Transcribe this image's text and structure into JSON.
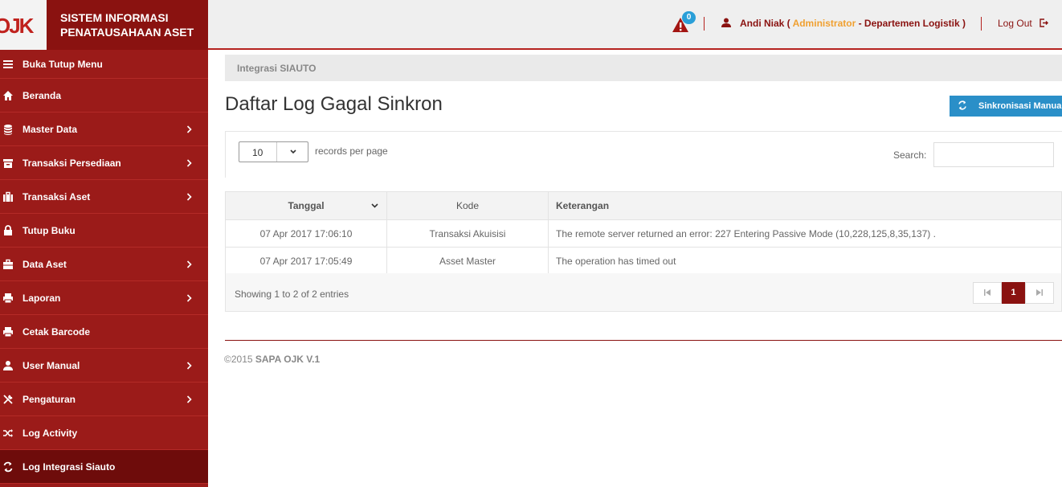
{
  "brand": {
    "logo_text": "OJK",
    "title_line1": "SISTEM INFORMASI",
    "title_line2": "PENATAUSAHAAN ASET"
  },
  "header": {
    "notification_count": "0",
    "user_name": "Andi Niak (",
    "user_role": "Administrator",
    "user_dept": "- Departemen Logistik )",
    "logout_label": "Log Out"
  },
  "sidebar": {
    "items": [
      {
        "label": "Buka Tutup Menu",
        "icon": "menu-icon",
        "chevron": false
      },
      {
        "label": "Beranda",
        "icon": "home-icon",
        "chevron": false
      },
      {
        "label": "Master Data",
        "icon": "database-icon",
        "chevron": true
      },
      {
        "label": "Transaksi Persediaan",
        "icon": "archive-icon",
        "chevron": true
      },
      {
        "label": "Transaksi Aset",
        "icon": "briefcase-icon",
        "chevron": true
      },
      {
        "label": "Tutup Buku",
        "icon": "lock-icon",
        "chevron": false
      },
      {
        "label": "Data Aset",
        "icon": "suitcase-icon",
        "chevron": true
      },
      {
        "label": "Laporan",
        "icon": "printer-icon",
        "chevron": true
      },
      {
        "label": "Cetak Barcode",
        "icon": "printer-icon",
        "chevron": false
      },
      {
        "label": "User Manual",
        "icon": "user-icon",
        "chevron": true
      },
      {
        "label": "Pengaturan",
        "icon": "tools-icon",
        "chevron": true
      },
      {
        "label": "Log Activity",
        "icon": "shuffle-icon",
        "chevron": false
      },
      {
        "label": "Log Integrasi Siauto",
        "icon": "refresh-icon",
        "chevron": false,
        "active": true
      }
    ]
  },
  "breadcrumb": "Integrasi SIAUTO",
  "page_title": "Daftar Log Gagal Sinkron",
  "sync_button": "Sinkronisasi Manual",
  "table_controls": {
    "per_page_value": "10",
    "per_page_label": "records per page",
    "search_label": "Search:"
  },
  "table": {
    "headers": [
      "Tanggal",
      "Kode",
      "Keterangan"
    ],
    "rows": [
      [
        "07 Apr 2017 17:06:10",
        "Transaksi Akuisisi",
        "The remote server returned an error: 227 Entering Passive Mode (10,228,125,8,35,137) ."
      ],
      [
        "07 Apr 2017 17:05:49",
        "Asset Master",
        "The operation has timed out"
      ]
    ]
  },
  "pagination": {
    "info": "Showing 1 to 2 of 2 entries",
    "current": "1"
  },
  "footer": {
    "year": "©2015",
    "app": "SAPA OJK V.1"
  },
  "colors": {
    "brand_dark": "#8a1210",
    "sidebar": "#9b1b19",
    "accent_blue": "#2a8fc8",
    "role_orange": "#f0a030"
  }
}
